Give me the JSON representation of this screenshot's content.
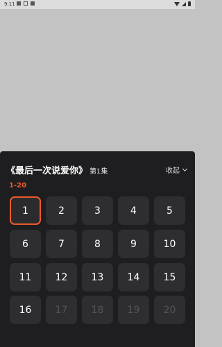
{
  "status_bar": {
    "time": "9:11"
  },
  "panel": {
    "title": "《最后一次说爱你》",
    "current_episode_label": "第1集",
    "collapse_label": "收起",
    "range_label": "1-20",
    "accent_color": "#ee5a2c",
    "episodes": [
      {
        "label": "1",
        "state": "selected"
      },
      {
        "label": "2",
        "state": "available"
      },
      {
        "label": "3",
        "state": "available"
      },
      {
        "label": "4",
        "state": "available"
      },
      {
        "label": "5",
        "state": "available"
      },
      {
        "label": "6",
        "state": "available"
      },
      {
        "label": "7",
        "state": "available"
      },
      {
        "label": "8",
        "state": "available"
      },
      {
        "label": "9",
        "state": "available"
      },
      {
        "label": "10",
        "state": "available"
      },
      {
        "label": "11",
        "state": "available"
      },
      {
        "label": "12",
        "state": "available"
      },
      {
        "label": "13",
        "state": "available"
      },
      {
        "label": "14",
        "state": "available"
      },
      {
        "label": "15",
        "state": "available"
      },
      {
        "label": "16",
        "state": "available"
      },
      {
        "label": "17",
        "state": "locked"
      },
      {
        "label": "18",
        "state": "locked"
      },
      {
        "label": "19",
        "state": "locked"
      },
      {
        "label": "20",
        "state": "locked"
      }
    ]
  }
}
